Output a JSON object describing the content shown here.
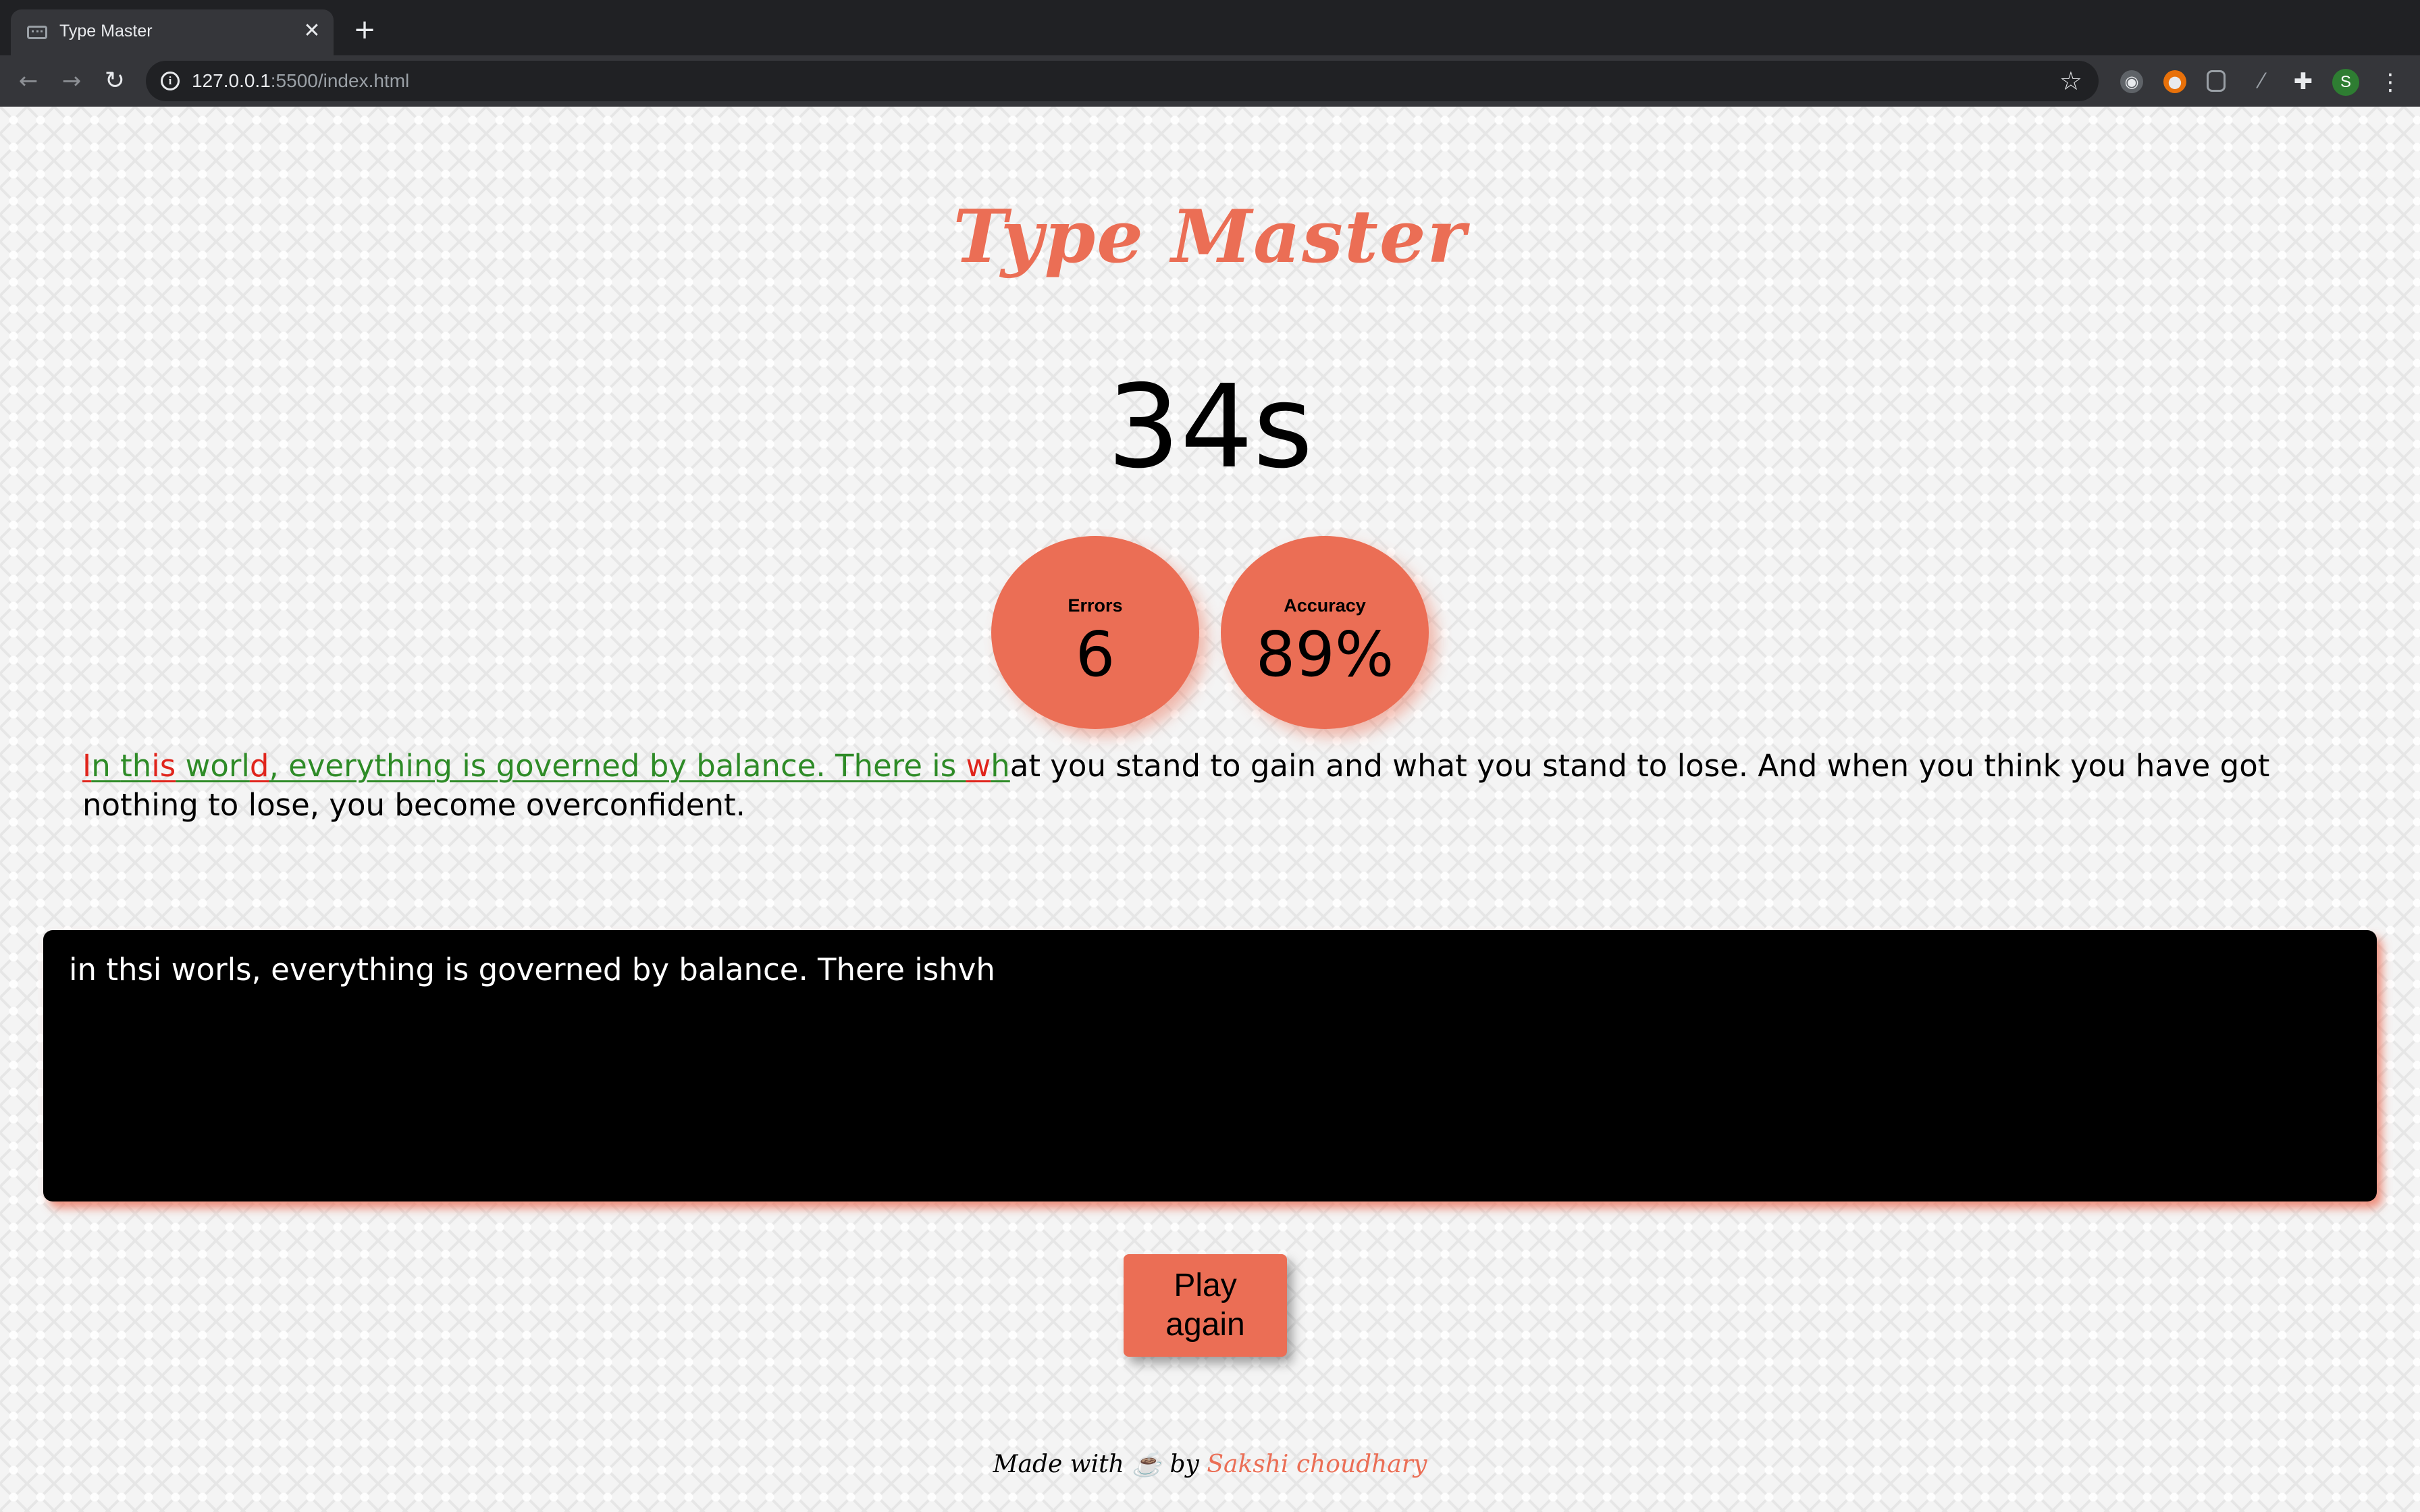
{
  "browser": {
    "tab_title": "Type Master",
    "tab_close": "✕",
    "new_tab": "+",
    "url_host": "127.0.0.1",
    "url_rest": ":5500/index.html",
    "icons": [
      "keyboard-favicon-icon",
      "back-icon",
      "forward-icon",
      "reload-icon",
      "info-icon",
      "star-icon",
      "extension-icon",
      "puzzle-icon",
      "menu-icon"
    ],
    "profile_initial": "S"
  },
  "app": {
    "title": "Type Master",
    "timer": "34s",
    "stats": {
      "errors_label": "Errors",
      "errors_value": "6",
      "accuracy_label": "Accuracy",
      "accuracy_value": "89%"
    },
    "quote_segments": [
      {
        "text": "I",
        "state": "wrong"
      },
      {
        "text": "n ",
        "state": "correct"
      },
      {
        "text": "th",
        "state": "correct"
      },
      {
        "text": "is",
        "state": "wrong"
      },
      {
        "text": " worl",
        "state": "correct"
      },
      {
        "text": "d",
        "state": "wrong"
      },
      {
        "text": ", everything is governed by balance. There is ",
        "state": "correct"
      },
      {
        "text": "w",
        "state": "wrong"
      },
      {
        "text": "h",
        "state": "correct"
      },
      {
        "text": "at you stand to gain and what you stand to lose. And when you think you have got nothing to lose, you become overconfident.",
        "state": "pending"
      }
    ],
    "typed_text": "in thsi worls, everything is governed by balance. There ishvh",
    "play_again_label": "Play again",
    "footer": {
      "prefix": "Made with ☕ by ",
      "author": "Sakshi choudhary"
    },
    "colors": {
      "accent": "#eb6e55",
      "correct": "#2e8b27",
      "wrong": "#e0251c"
    }
  }
}
